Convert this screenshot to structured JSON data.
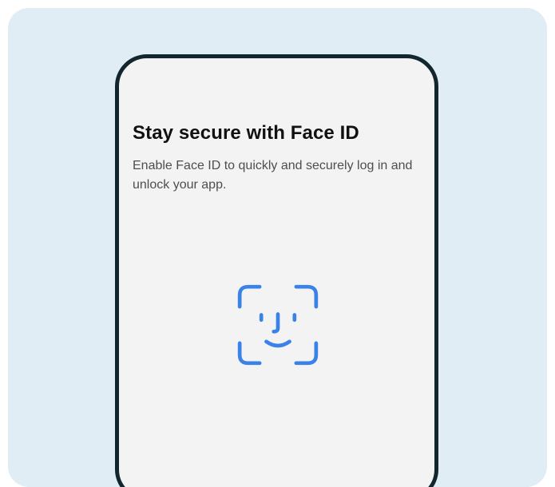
{
  "screen": {
    "title": "Stay secure with Face ID",
    "description": "Enable Face ID to quickly and securely log in and unlock your app."
  },
  "icon": {
    "name": "face-id-icon",
    "color": "#3b82e8"
  },
  "colors": {
    "background": "#e0edf4",
    "phone_frame": "#12262d",
    "phone_screen": "#f3f3f3"
  }
}
